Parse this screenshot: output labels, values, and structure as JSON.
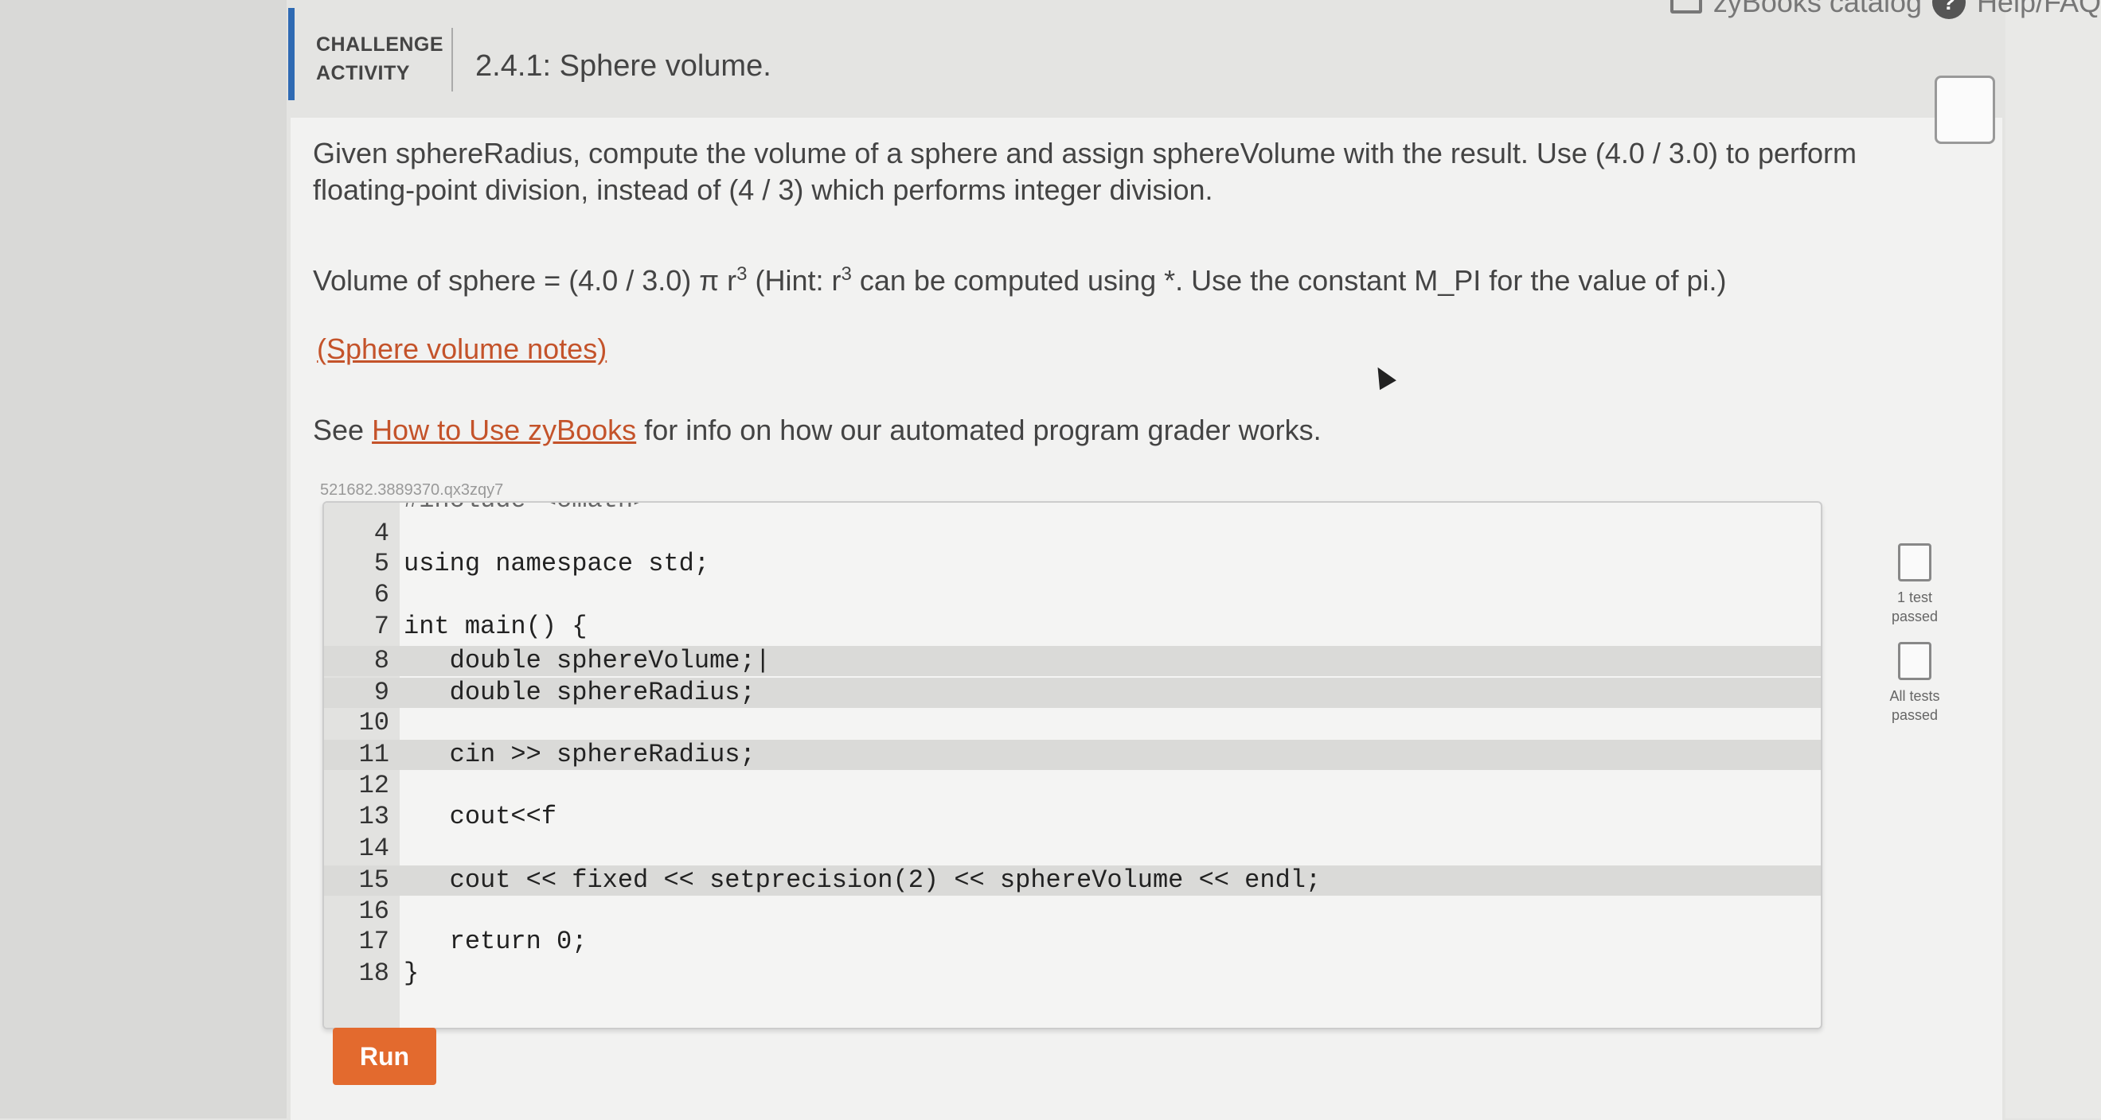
{
  "topbar": {
    "catalog": "zyBooks catalog",
    "help": "Help/FAQ"
  },
  "header": {
    "label_line1": "CHALLENGE",
    "label_line2": "ACTIVITY",
    "title": "2.4.1: Sphere volume."
  },
  "instructions": {
    "p1": "Given sphereRadius, compute the volume of a sphere and assign sphereVolume with the result. Use (4.0 / 3.0) to perform floating-point division, instead of (4 / 3) which performs integer division.",
    "formula_part1": "Volume of sphere = (4.0 / 3.0) π r",
    "formula_sup1": "3",
    "formula_part2": " (Hint: r",
    "formula_sup2": "3",
    "formula_part3": " can be computed using *. Use the constant M_PI for the value of pi.)",
    "notes_link": "(Sphere volume notes)",
    "see_prefix": "See ",
    "see_link": "How to Use zyBooks",
    "see_suffix": " for info on how our automated program grader works."
  },
  "editor": {
    "id": "521682.3889370.qx3zqy7",
    "cut_line": "#include <cmath>",
    "lines": [
      {
        "n": "4",
        "code": ""
      },
      {
        "n": "5",
        "code": "using namespace std;"
      },
      {
        "n": "6",
        "code": ""
      },
      {
        "n": "7",
        "code": "int main() {"
      },
      {
        "n": "8",
        "code": "   double sphereVolume;|"
      },
      {
        "n": "9",
        "code": "   double sphereRadius;"
      },
      {
        "n": "10",
        "code": ""
      },
      {
        "n": "11",
        "code": "   cin >> sphereRadius;"
      },
      {
        "n": "12",
        "code": ""
      },
      {
        "n": "13",
        "code": "   cout<<f"
      },
      {
        "n": "14",
        "code": ""
      },
      {
        "n": "15",
        "code": "   cout << fixed << setprecision(2) << sphereVolume << endl;"
      },
      {
        "n": "16",
        "code": ""
      },
      {
        "n": "17",
        "code": "   return 0;"
      },
      {
        "n": "18",
        "code": "}"
      }
    ]
  },
  "tests": {
    "one": "1 test passed",
    "all": "All tests passed"
  },
  "run_label": "Run"
}
